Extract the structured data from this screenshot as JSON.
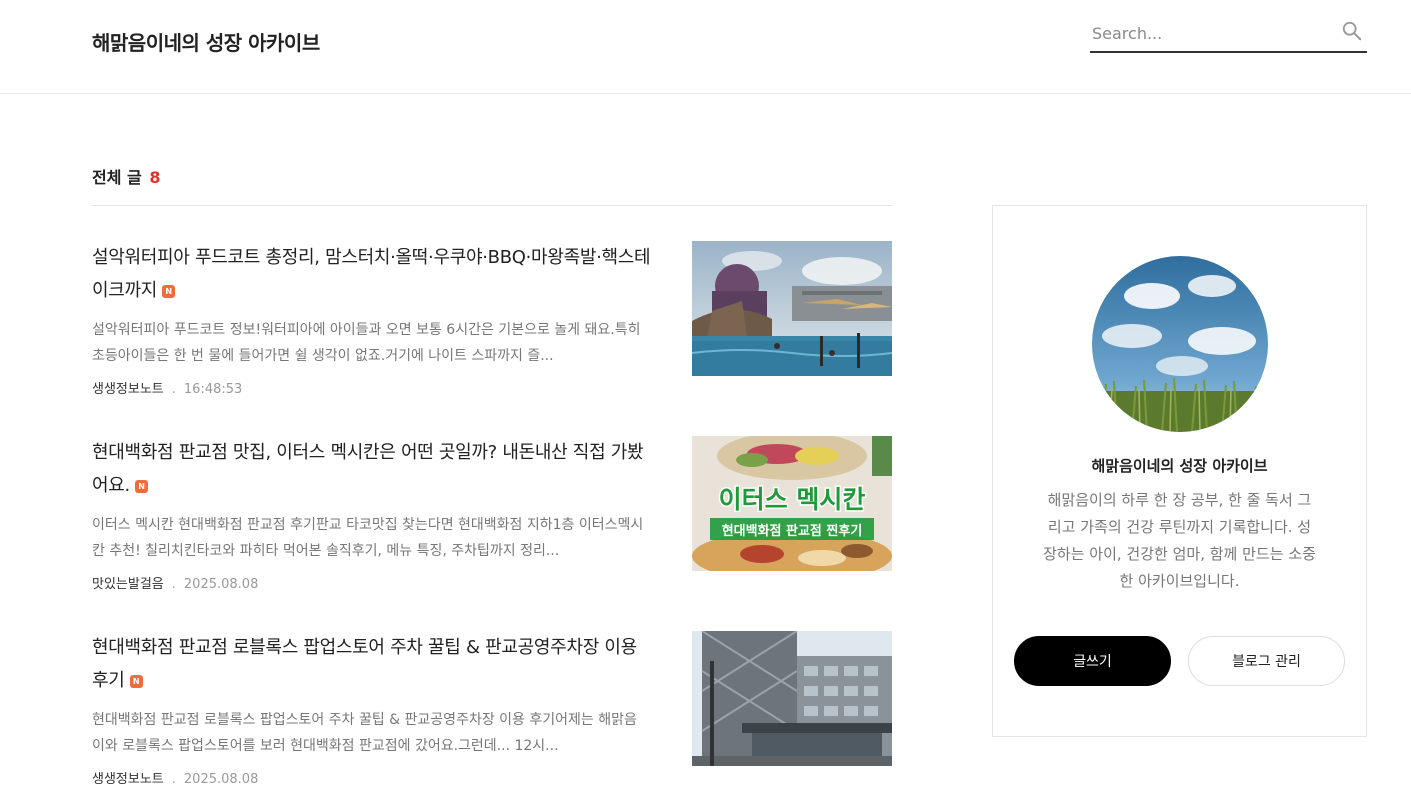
{
  "header": {
    "blog_title": "해맑음이네의 성장 아카이브",
    "search_placeholder": "Search..."
  },
  "section": {
    "label": "전체 글",
    "count": "8"
  },
  "posts": [
    {
      "title": "설악워터피아 푸드코트 총정리, 맘스터치·올떡·우쿠야·BBQ·마왕족발·핵스테이크까지",
      "new_badge": "N",
      "excerpt": "설악워터피아 푸드코트 정보!워터피아에 아이들과 오면 보통 6시간은 기본으로 놀게 돼요.특히 초등아이들은 한 번 물에 들어가면 쉴 생각이 없죠.거기에 나이트 스파까지 즐...",
      "category": "생생정보노트",
      "separator": ".",
      "time": "16:48:53"
    },
    {
      "title": "현대백화점 판교점 맛집, 이터스 멕시칸은 어떤 곳일까? 내돈내산 직접 가봤어요.",
      "new_badge": "N",
      "excerpt": "이터스 멕시칸 현대백화점 판교점 후기판교 타코맛집 찾는다면 현대백화점 지하1층 이터스멕시칸 추천! 칠리치킨타코와 파히타 먹어본 솔직후기, 메뉴 특징, 주차팁까지 정리...",
      "category": "맛있는발걸음",
      "separator": ".",
      "time": "2025.08.08",
      "thumb_text_1": "이터스 멕시칸",
      "thumb_text_2": "현대백화점 판교점 찐후기"
    },
    {
      "title": "현대백화점 판교점 로블록스 팝업스토어 주차 꿀팁 & 판교공영주차장 이용 후기",
      "new_badge": "N",
      "excerpt": "현대백화점 판교점 로블록스 팝업스토어 주차 꿀팁 & 판교공영주차장 이용 후기어제는 해맑음이와 로블록스 팝업스토어를 보러 현대백화점 판교점에 갔어요.그런데... 12시...",
      "category": "생생정보노트",
      "separator": ".",
      "time": "2025.08.08"
    }
  ],
  "sidebar": {
    "name": "해맑음이네의 성장 아카이브",
    "description": "해맑음이의 하루 한 장 공부, 한 줄 독서 그리고 가족의 건강 루틴까지 기록합니다. 성장하는 아이, 건강한 엄마, 함께 만드는 소중한 아카이브입니다.",
    "write_button": "글쓰기",
    "manage_button": "블로그 관리"
  },
  "colors": {
    "accent_count": "#e03131",
    "new_badge": "#f26b3a",
    "primary_button": "#000000"
  }
}
